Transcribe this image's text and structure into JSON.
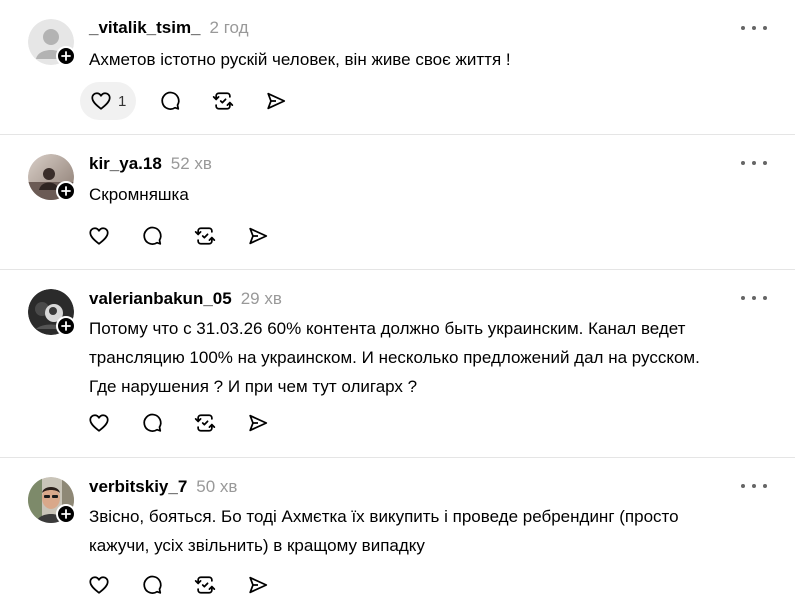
{
  "comments": [
    {
      "username": "_vitalik_tsim_",
      "time": "2 год",
      "text": "Ахметов істотно рускій человек, він живе своє життя !",
      "likes": "1"
    },
    {
      "username": "kir_ya.18",
      "time": "52 хв",
      "text": "Скромняшка"
    },
    {
      "username": "valerianbakun_05",
      "time": "29 хв",
      "text_lines": [
        "Потому что с 31.03.26 60% контента должно быть украинским. Канал ведет",
        "трансляцию 100% на украинском. И несколько предложений дал на русском.",
        "Где нарушения ? И при чем тут олигарх ?"
      ]
    },
    {
      "username": "verbitskiy_7",
      "time": "50 хв",
      "text_lines": [
        "Звісно, бояться. Бо тоді Ахмєтка їх викупить і проведе ребрендинг (просто",
        "кажучи, усіх звільнить) в кращому випадку"
      ]
    }
  ],
  "icons": {
    "like": "heart-icon",
    "reply": "speech-bubble-icon",
    "repost": "repost-icon",
    "share": "send-icon",
    "more": "more-horizontal-icon",
    "follow": "plus-icon"
  },
  "colors": {
    "text": "#000000",
    "muted": "#999999",
    "divider": "#e5e5e5",
    "like_bg": "#f1f1f1"
  }
}
